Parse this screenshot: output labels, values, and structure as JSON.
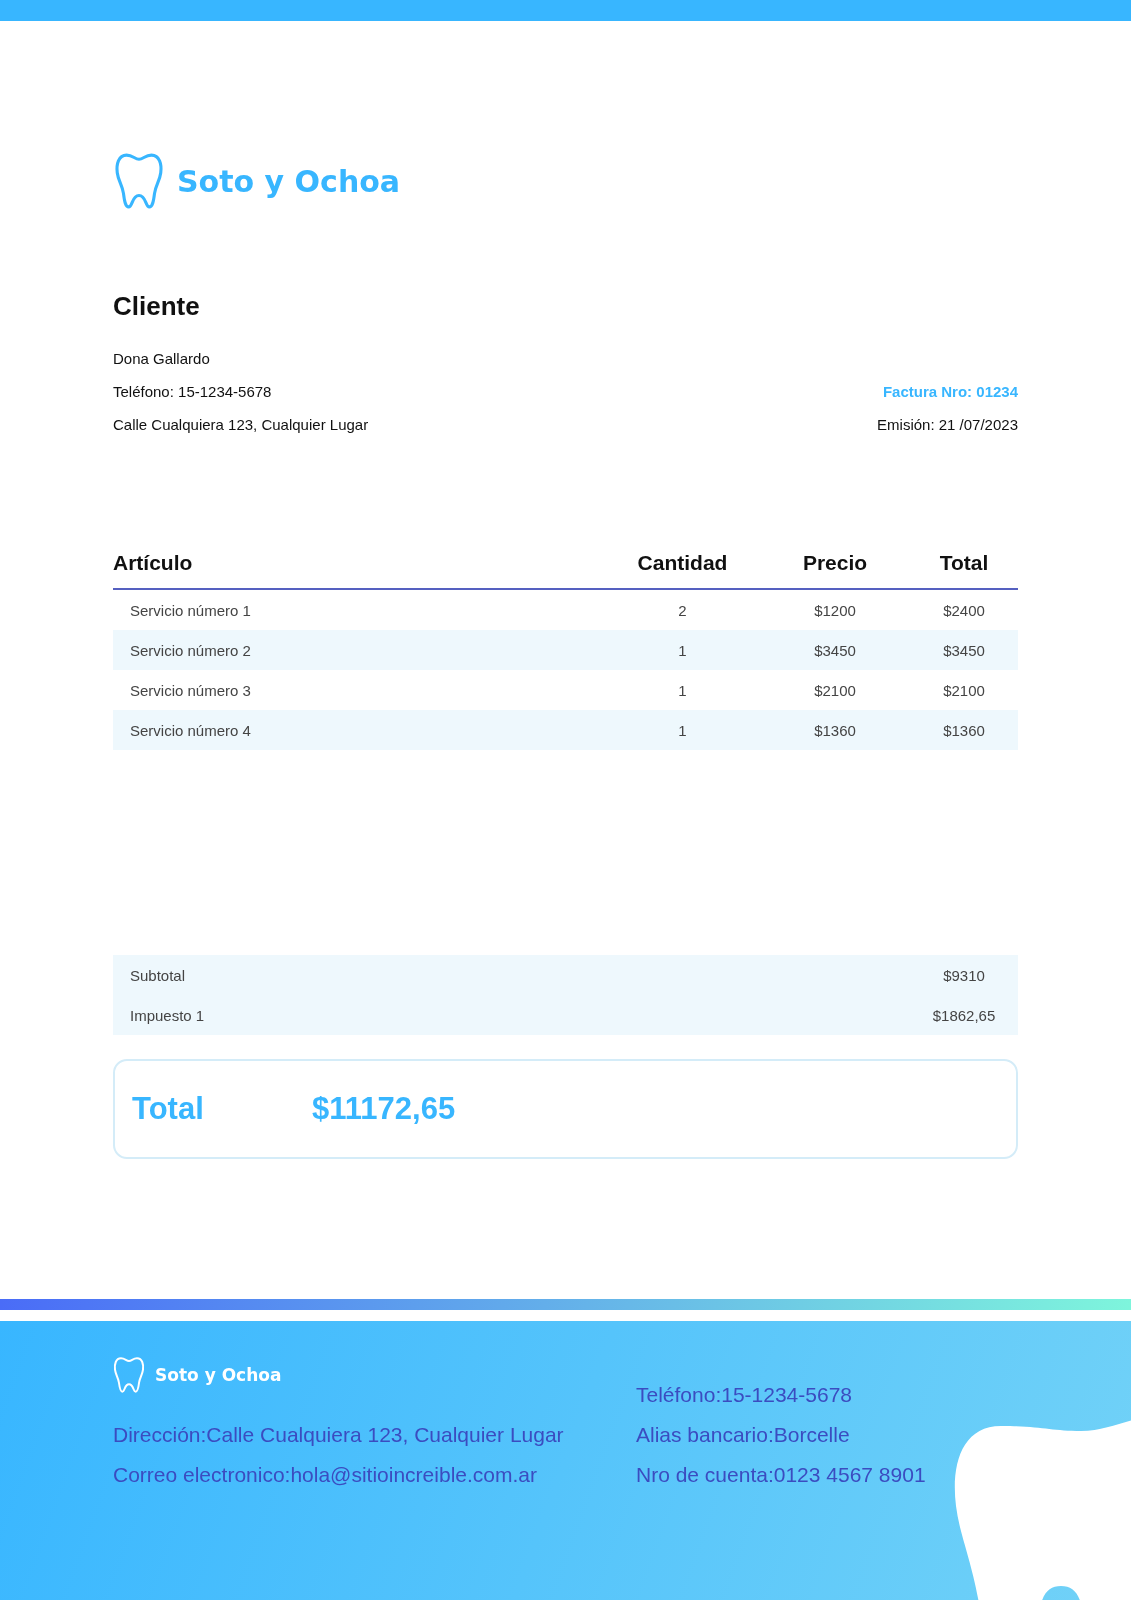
{
  "brand": {
    "name": "Soto y Ochoa"
  },
  "client": {
    "heading": "Cliente",
    "name": "Dona Gallardo",
    "phone": "Teléfono: 15-1234-5678",
    "address": "Calle Cualquiera 123, Cualquier Lugar"
  },
  "invoice": {
    "number": "Factura Nro: 01234",
    "issued": "Emisión: 21 /07/2023"
  },
  "table": {
    "columns": [
      "Artículo",
      "Cantidad",
      "Precio",
      "Total"
    ],
    "rows": [
      {
        "cells": [
          "Servicio número 1",
          "2",
          "$1200",
          "$2400"
        ]
      },
      {
        "cells": [
          "Servicio número 2",
          "1",
          "$3450",
          "$3450"
        ]
      },
      {
        "cells": [
          "Servicio número 3",
          "1",
          "$2100",
          "$2100"
        ]
      },
      {
        "cells": [
          "Servicio número 4",
          "1",
          "$1360",
          "$1360"
        ]
      }
    ]
  },
  "summary": [
    {
      "label": "Subtotal",
      "value": "$9310"
    },
    {
      "label": "Impuesto 1",
      "value": "$1862,65"
    }
  ],
  "total": {
    "label": "Total",
    "value": "$11172,65"
  },
  "footer": {
    "brand": "Soto y Ochoa",
    "left": [
      "Dirección:Calle Cualquiera 123, Cualquier Lugar",
      "Correo electronico:hola@sitioincreible.com.ar"
    ],
    "right": [
      "Teléfono:15-1234-5678",
      "Alias bancario:Borcelle",
      "Nro de cuenta:0123 4567 8901"
    ]
  }
}
